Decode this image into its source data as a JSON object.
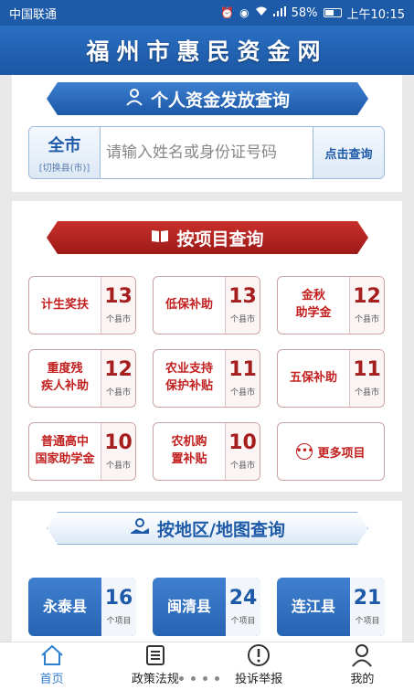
{
  "status_bar": {
    "carrier": "中国联通",
    "battery": "58%",
    "battery_level": 0.58,
    "time": "上午10:15",
    "icons": [
      "alarm-icon",
      "eye-icon",
      "wifi-icon",
      "signal-icon",
      "battery-icon"
    ]
  },
  "header": {
    "title": "福州市惠民资金网"
  },
  "personal_query": {
    "banner": "个人资金发放查询",
    "banner_icon": "person-coin-icon",
    "city": "全市",
    "switch_label": "[切换县(市)]",
    "search_placeholder": "请输入姓名或身份证号码",
    "search_button": "点击查询"
  },
  "project_query": {
    "banner": "按项目查询",
    "banner_icon": "book-icon",
    "items": [
      {
        "name": "计生奖扶",
        "count": "13",
        "unit": "个县市"
      },
      {
        "name": "低保补助",
        "count": "13",
        "unit": "个县市"
      },
      {
        "name": "金秋\n助学金",
        "count": "12",
        "unit": "个县市"
      },
      {
        "name": "重度残\n疾人补助",
        "count": "12",
        "unit": "个县市"
      },
      {
        "name": "农业支持\n保护补贴",
        "count": "11",
        "unit": "个县市"
      },
      {
        "name": "五保补助",
        "count": "11",
        "unit": "个县市"
      },
      {
        "name": "普通高中\n国家助学金",
        "count": "10",
        "unit": "个县市"
      },
      {
        "name": "农机购\n置补贴",
        "count": "10",
        "unit": "个县市"
      }
    ],
    "more_label": "更多项目",
    "more_icon": "ellipsis-circle-icon"
  },
  "region_query": {
    "banner": "按地区/地图查询",
    "banner_icon": "map-icon",
    "items": [
      {
        "name": "永泰县",
        "count": "16",
        "unit": "个项目"
      },
      {
        "name": "闽清县",
        "count": "24",
        "unit": "个项目"
      },
      {
        "name": "连江县",
        "count": "21",
        "unit": "个项目"
      }
    ]
  },
  "bottom_nav": [
    {
      "label": "首页",
      "icon": "home-icon",
      "active": true
    },
    {
      "label": "政策法规",
      "icon": "document-icon",
      "active": false
    },
    {
      "label": "投诉举报",
      "icon": "alert-icon",
      "active": false
    },
    {
      "label": "我的",
      "icon": "user-icon",
      "active": false
    }
  ],
  "colors": {
    "primary_blue": "#1d5aa8",
    "accent_red": "#b02320",
    "active_nav": "#2f7fd1"
  }
}
